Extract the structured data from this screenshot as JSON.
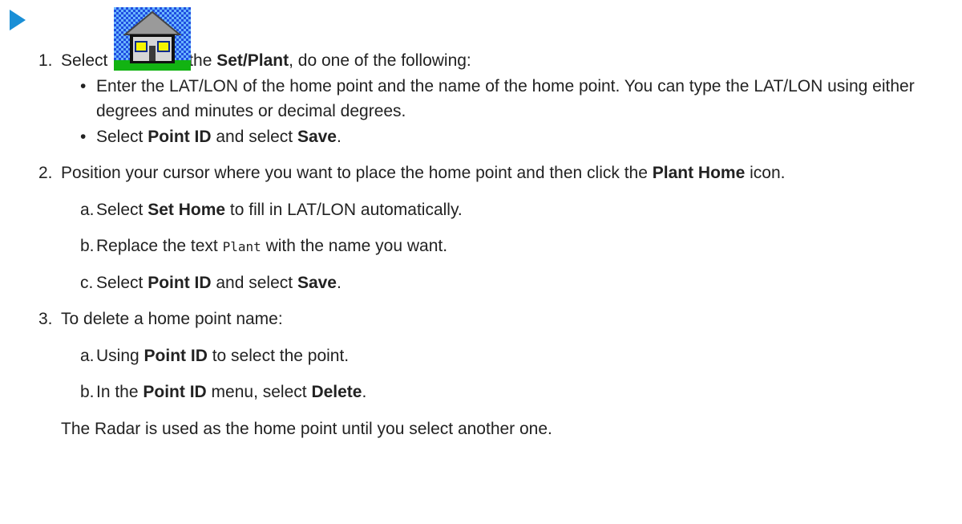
{
  "step1": {
    "num": "1.",
    "before": "Select ",
    "icon": "home-point-icon",
    "mid": ". In the ",
    "bold": "Set/Plant",
    "after": ", do one of the following:",
    "bullets": [
      {
        "text": "Enter the LAT/LON of the home point and the name of the home point. You can type the LAT/LON using either degrees and minutes or decimal degrees."
      },
      {
        "before": "Select ",
        "bold1": "Point ID",
        "mid": " and select ",
        "bold2": "Save",
        "after": "."
      }
    ]
  },
  "step2": {
    "num": "2.",
    "before": "Position your cursor where you want to place the home point and then click the ",
    "bold": "Plant Home",
    "after": " icon.",
    "a": {
      "letter": "a.",
      "before": "Select ",
      "bold": "Set Home",
      "after": " to fill in LAT/LON automatically."
    },
    "b": {
      "letter": "b.",
      "before": "Replace the text ",
      "code": "Plant",
      "after": " with the name you want."
    },
    "c": {
      "letter": "c.",
      "before": "Select ",
      "bold1": "Point ID",
      "mid": " and select ",
      "bold2": "Save",
      "after": "."
    }
  },
  "step3": {
    "num": "3.",
    "text": "To delete a home point name:",
    "a": {
      "letter": "a.",
      "before": "Using ",
      "bold": "Point ID",
      "after": " to select the point."
    },
    "b": {
      "letter": "b.",
      "before": "In the ",
      "bold1": "Point ID",
      "mid": " menu, select ",
      "bold2": "Delete",
      "after": "."
    },
    "note": "The Radar is used as the home point until you select another one."
  }
}
